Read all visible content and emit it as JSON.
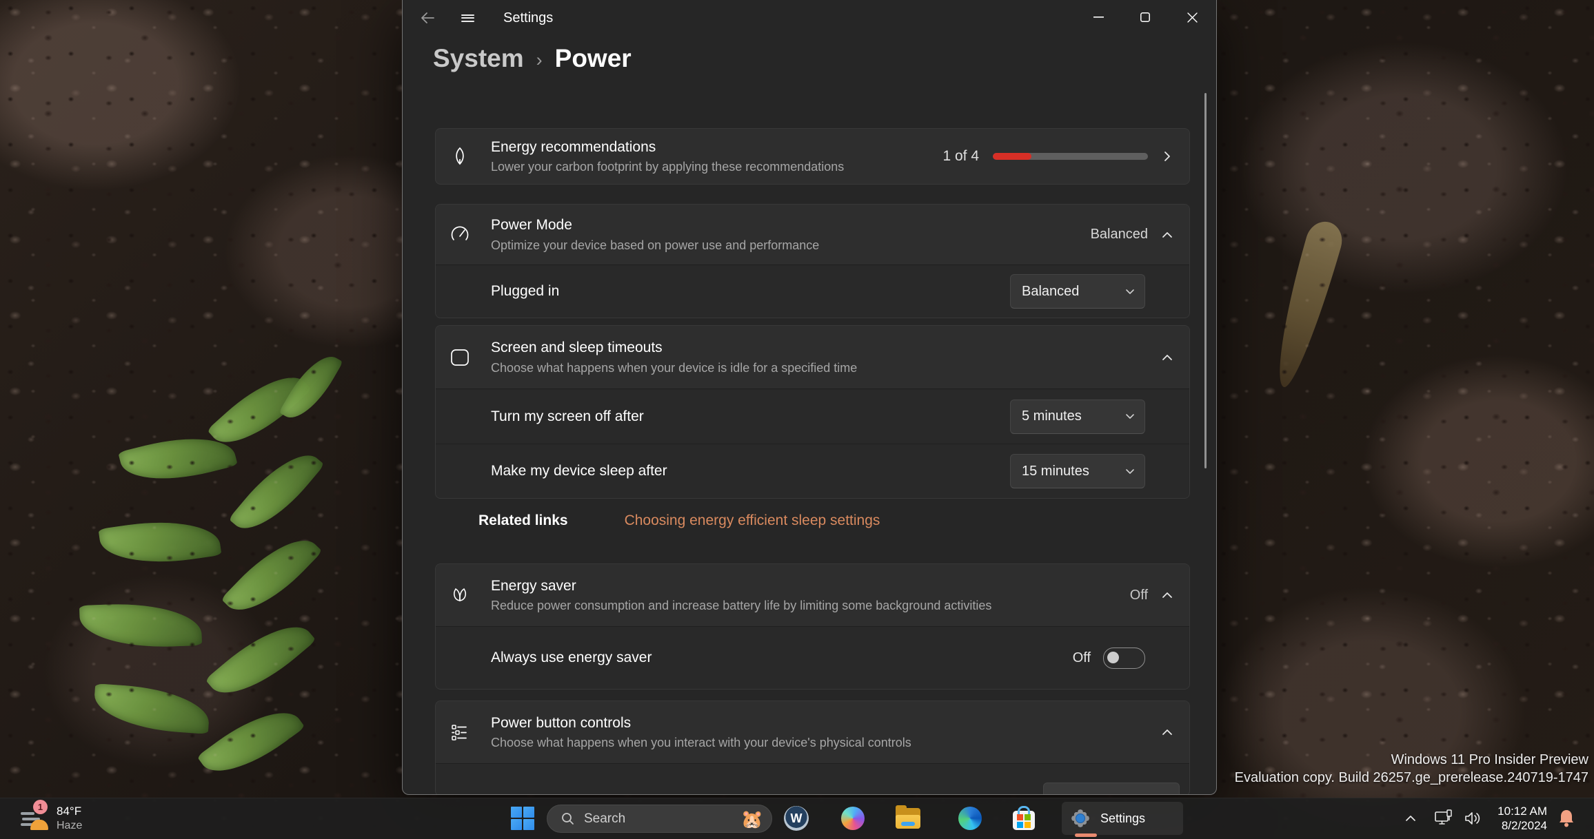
{
  "titlebar": {
    "app_title": "Settings"
  },
  "breadcrumb": {
    "parent": "System",
    "separator": "›",
    "current": "Power"
  },
  "page": {
    "energy_recommendations": {
      "title": "Energy recommendations",
      "subtitle": "Lower your carbon footprint by applying these recommendations",
      "progress_label": "1 of 4",
      "progress_percent": 25
    },
    "power_mode": {
      "title": "Power Mode",
      "subtitle": "Optimize your device based on power use and performance",
      "value": "Balanced",
      "rows": [
        {
          "label": "Plugged in",
          "value": "Balanced"
        }
      ]
    },
    "screen_sleep": {
      "title": "Screen and sleep timeouts",
      "subtitle": "Choose what happens when your device is idle for a specified time",
      "rows": [
        {
          "label": "Turn my screen off after",
          "value": "5 minutes"
        },
        {
          "label": "Make my device sleep after",
          "value": "15 minutes"
        }
      ]
    },
    "related_links": {
      "label": "Related links",
      "link_text": "Choosing energy efficient sleep settings"
    },
    "energy_saver": {
      "title": "Energy saver",
      "subtitle": "Reduce power consumption and increase battery life by limiting some background activities",
      "value": "Off",
      "rows": [
        {
          "label": "Always use energy saver",
          "value": "Off"
        }
      ]
    },
    "power_button": {
      "title": "Power button controls",
      "subtitle": "Choose what happens when you interact with your device's physical controls"
    }
  },
  "watermark": {
    "line1": "Windows 11 Pro Insider Preview",
    "line2": "Evaluation copy. Build 26257.ge_prerelease.240719-1747"
  },
  "taskbar": {
    "weather": {
      "badge": "1",
      "temperature": "84°F",
      "condition": "Haze"
    },
    "search": {
      "placeholder": "Search"
    },
    "settings_app_label": "Settings",
    "clock": {
      "time": "10:12 AM",
      "date": "8/2/2024"
    }
  },
  "icons": {
    "search_companion": "🐹",
    "w_badge": "W"
  },
  "colors": {
    "link": "#d98a5f",
    "progress_red": "#d72f26",
    "accent_blue": "#2f8ceb",
    "taskbar_underline": "#ea8a70"
  }
}
